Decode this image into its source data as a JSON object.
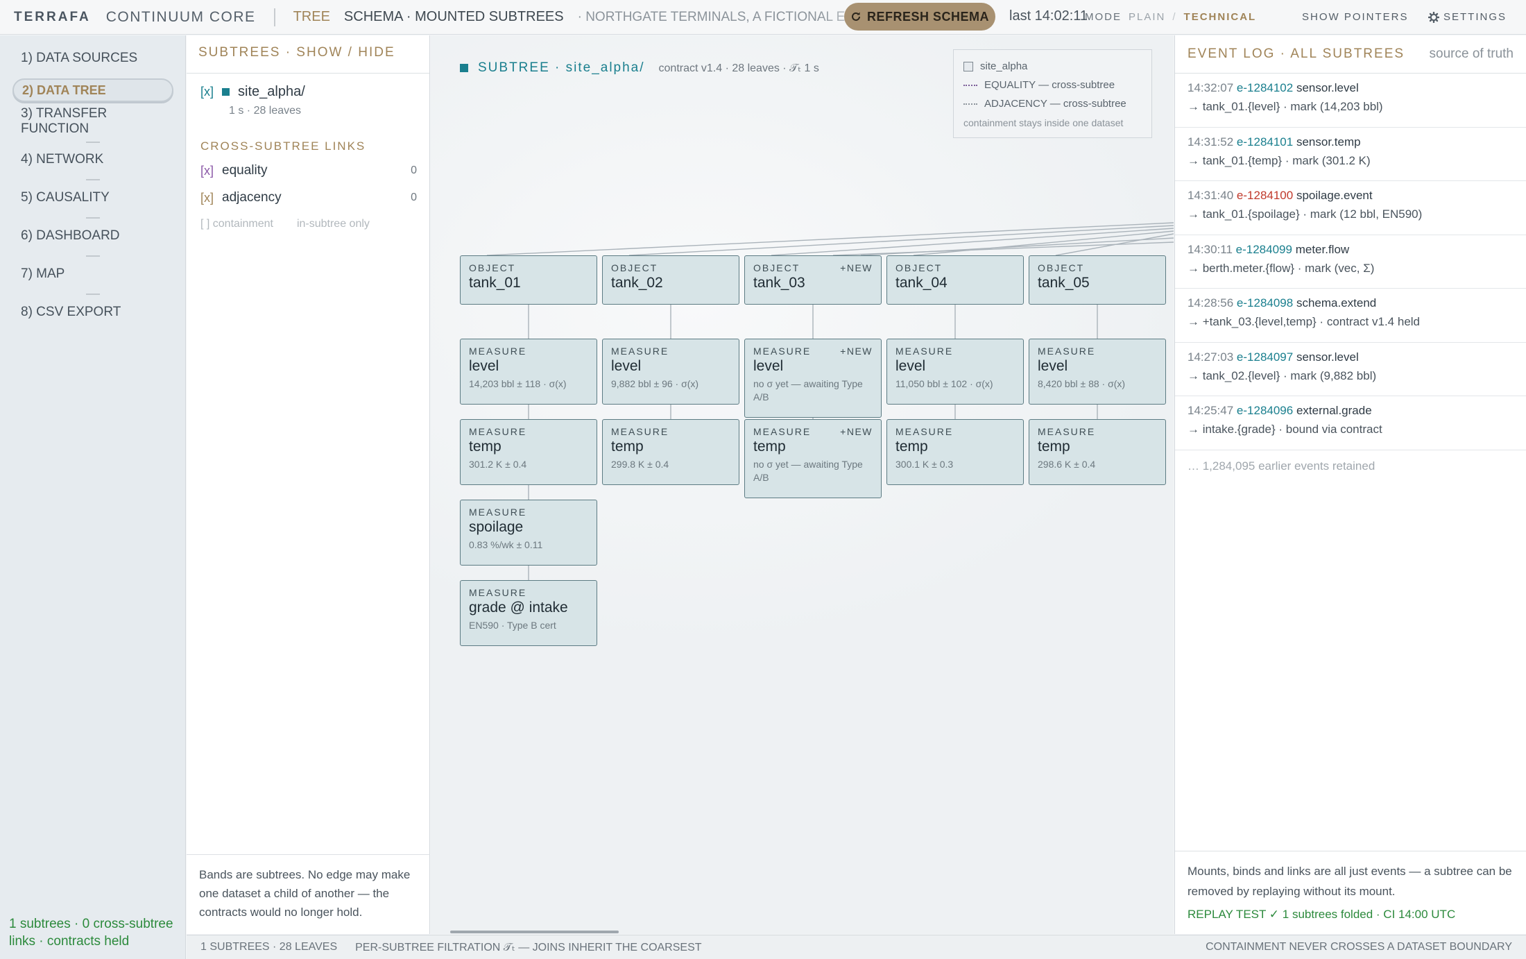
{
  "topbar": {
    "brand": "TERRAFA",
    "product": "CONTINUUM CORE",
    "crumb_tree": "TREE",
    "crumb_schema": "SCHEMA · MOUNTED SUBTREES",
    "crumb_site": "· NORTHGATE TERMINALS, A FICTIONAL EUROPEAN",
    "refresh_label": "REFRESH SCHEMA",
    "refresh_icon": "refresh-icon",
    "last_sync": "last 14:02:11",
    "mode_label": "MODE",
    "mode_plain": "PLAIN",
    "mode_sep": "/",
    "mode_technical": "TECHNICAL",
    "show_pointers": "SHOW POINTERS",
    "settings": "SETTINGS",
    "settings_icon": "gear-icon"
  },
  "nav": {
    "items": [
      {
        "label": "1) DATA SOURCES",
        "active": false
      },
      {
        "label": "2) DATA TREE",
        "active": true
      },
      {
        "label": "3) TRANSFER FUNCTION",
        "active": false
      },
      {
        "label": "4) NETWORK",
        "active": false
      },
      {
        "label": "5) CAUSALITY",
        "active": false
      },
      {
        "label": "6) DASHBOARD",
        "active": false
      },
      {
        "label": "7) MAP",
        "active": false
      },
      {
        "label": "8) CSV EXPORT",
        "active": false
      }
    ],
    "status": "1 subtrees · 0 cross-subtree links · contracts held"
  },
  "subtrees": {
    "header": "SUBTREES · SHOW / HIDE",
    "item": {
      "check": "[x]",
      "name": "site_alpha/",
      "meta": "1 s · 28 leaves"
    },
    "links_header": "CROSS-SUBTREE LINKS",
    "links": [
      {
        "check": "[x]",
        "name": "equality",
        "count": "0"
      },
      {
        "check": "[x]",
        "name": "adjacency",
        "count": "0"
      }
    ],
    "containment": {
      "label": "[ ] containment",
      "note": "in-subtree only"
    },
    "note": "Bands are subtrees. No edge may make one dataset a child of another — the contracts would no longer hold."
  },
  "canvas": {
    "subtree_label": "SUBTREE · site_alpha/",
    "subtree_meta": "contract v1.4 · 28 leaves · 𝒯ₜ 1 s",
    "legend": {
      "box_label": "site_alpha",
      "equality": "EQUALITY — cross-subtree",
      "adjacency": "ADJACENCY — cross-subtree",
      "note": "containment stays inside one dataset"
    },
    "columns": [
      {
        "object": {
          "kind": "OBJECT",
          "name": "tank_01",
          "badge": ""
        },
        "measures": [
          {
            "kind": "MEASURE",
            "name": "level",
            "value": "14,203 bbl ± 118 · σ(x)",
            "badge": ""
          },
          {
            "kind": "MEASURE",
            "name": "temp",
            "value": "301.2 K ± 0.4",
            "badge": ""
          },
          {
            "kind": "MEASURE",
            "name": "spoilage",
            "value": "0.83 %/wk ± 0.11",
            "badge": ""
          },
          {
            "kind": "MEASURE",
            "name": "grade @ intake",
            "value": "EN590 · Type B cert",
            "badge": ""
          }
        ]
      },
      {
        "object": {
          "kind": "OBJECT",
          "name": "tank_02",
          "badge": ""
        },
        "measures": [
          {
            "kind": "MEASURE",
            "name": "level",
            "value": "9,882 bbl ± 96 · σ(x)",
            "badge": ""
          },
          {
            "kind": "MEASURE",
            "name": "temp",
            "value": "299.8 K ± 0.4",
            "badge": ""
          }
        ]
      },
      {
        "object": {
          "kind": "OBJECT",
          "name": "tank_03",
          "badge": "+NEW"
        },
        "measures": [
          {
            "kind": "MEASURE",
            "name": "level",
            "value": "no σ yet — awaiting Type A/B",
            "badge": "+NEW"
          },
          {
            "kind": "MEASURE",
            "name": "temp",
            "value": "no σ yet — awaiting Type A/B",
            "badge": "+NEW"
          }
        ]
      },
      {
        "object": {
          "kind": "OBJECT",
          "name": "tank_04",
          "badge": ""
        },
        "measures": [
          {
            "kind": "MEASURE",
            "name": "level",
            "value": "11,050 bbl ± 102 · σ(x)",
            "badge": ""
          },
          {
            "kind": "MEASURE",
            "name": "temp",
            "value": "300.1 K ± 0.3",
            "badge": ""
          }
        ]
      },
      {
        "object": {
          "kind": "OBJECT",
          "name": "tank_05",
          "badge": ""
        },
        "measures": [
          {
            "kind": "MEASURE",
            "name": "level",
            "value": "8,420 bbl ± 88 · σ(x)",
            "badge": ""
          },
          {
            "kind": "MEASURE",
            "name": "temp",
            "value": "298.6 K ± 0.4",
            "badge": ""
          }
        ]
      }
    ]
  },
  "eventlog": {
    "header": "EVENT LOG · ALL SUBTREES",
    "source": "source of truth",
    "events": [
      {
        "time": "14:32:07",
        "id": "e-1284102",
        "type": "sensor.level",
        "detail": "→ tank_01.{level} · mark (14,203 bbl)",
        "error": false
      },
      {
        "time": "14:31:52",
        "id": "e-1284101",
        "type": "sensor.temp",
        "detail": "→ tank_01.{temp} · mark (301.2 K)",
        "error": false
      },
      {
        "time": "14:31:40",
        "id": "e-1284100",
        "type": "spoilage.event",
        "detail": "→ tank_01.{spoilage} · mark (12 bbl, EN590)",
        "error": true
      },
      {
        "time": "14:30:11",
        "id": "e-1284099",
        "type": "meter.flow",
        "detail": "→ berth.meter.{flow} · mark (vec, Σ)",
        "error": false
      },
      {
        "time": "14:28:56",
        "id": "e-1284098",
        "type": "schema.extend",
        "detail": "→ +tank_03.{level,temp} · contract v1.4 held",
        "error": false
      },
      {
        "time": "14:27:03",
        "id": "e-1284097",
        "type": "sensor.level",
        "detail": "→ tank_02.{level} · mark (9,882 bbl)",
        "error": false
      },
      {
        "time": "14:25:47",
        "id": "e-1284096",
        "type": "external.grade",
        "detail": "→ intake.{grade} · bound via contract",
        "error": false
      }
    ],
    "more": "… 1,284,095 earlier events retained",
    "footer": "Mounts, binds and links are all just events — a subtree can be removed by replaying without its mount.",
    "replay": "REPLAY TEST ✓ 1 subtrees folded · CI 14:00 UTC"
  },
  "statusbar": {
    "left": "1 SUBTREES · 28 LEAVES",
    "mid": "PER-SUBTREE FILTRATION 𝒯ₜ — JOINS INHERIT THE COARSEST",
    "right": "CONTAINMENT NEVER CROSSES A DATASET BOUNDARY"
  }
}
